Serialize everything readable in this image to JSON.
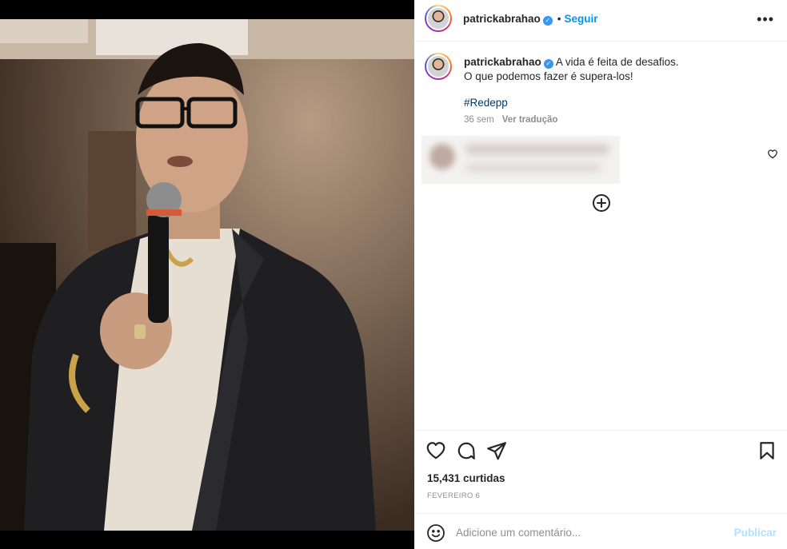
{
  "post": {
    "username": "patrickabrahao",
    "separator": "•",
    "follow_label": "Seguir",
    "more_label": "•••",
    "caption_line1": "A vida é feita de desafios.",
    "caption_line2": "O que podemos fazer é supera-los!",
    "hashtag": "#Redepp",
    "time_ago": "36 sem",
    "translate_label": "Ver tradução",
    "likes": "15,431 curtidas",
    "date": "FEVEREIRO 6"
  },
  "add_comment": {
    "placeholder": "Adicione um comentário...",
    "post_label": "Publicar"
  },
  "icons": [
    "heart-icon",
    "comment-icon",
    "share-icon",
    "bookmark-icon",
    "emoji-icon",
    "plus-circle-icon",
    "verified-badge-icon",
    "more-options-icon"
  ],
  "colors": {
    "accent": "#0095f6",
    "hashtag": "#00376b",
    "muted": "#8e8e8e",
    "post_disabled": "#b2dffc"
  }
}
